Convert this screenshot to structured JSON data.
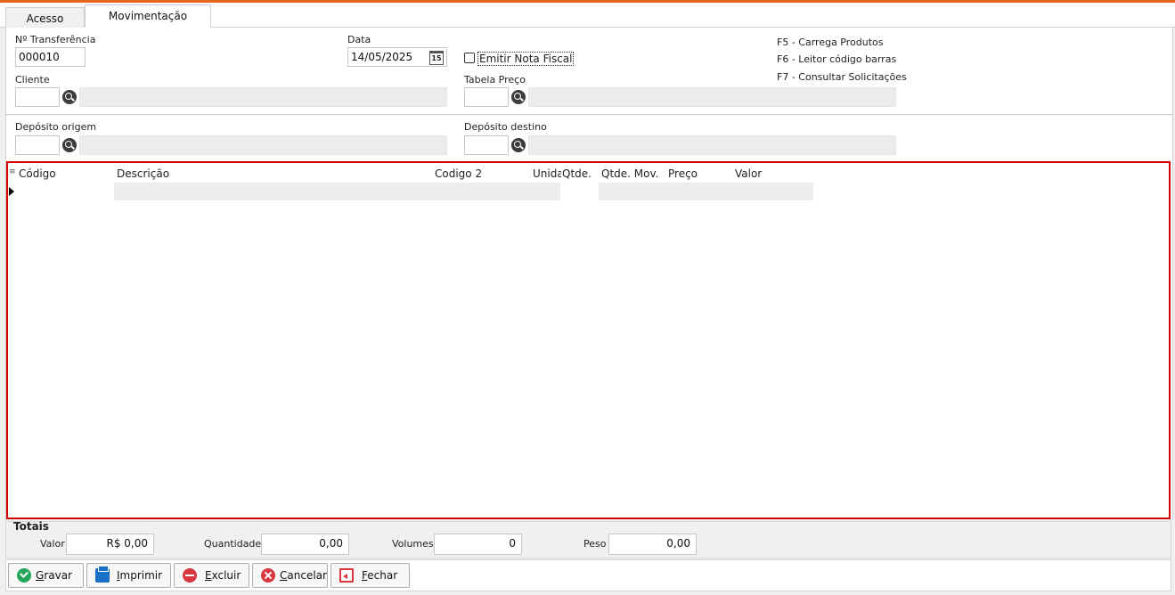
{
  "tabs": [
    {
      "label": "Acesso"
    },
    {
      "label": "Movimentação"
    }
  ],
  "form": {
    "transfer_number": {
      "label": "Nº Transferência",
      "value": "000010"
    },
    "date": {
      "label": "Data",
      "value": "14/05/2025"
    },
    "emit_invoice": {
      "label": "Emitir Nota Fiscal",
      "checked": false
    },
    "client": {
      "label": "Cliente",
      "code": "",
      "name": ""
    },
    "price_table": {
      "label": "Tabela Preço",
      "code": "",
      "name": ""
    },
    "origin_deposit": {
      "label": "Depósito origem",
      "code": "",
      "name": ""
    },
    "dest_deposit": {
      "label": "Depósito destino",
      "code": "",
      "name": ""
    },
    "shortcuts": [
      "F5 - Carrega Produtos",
      "F6 - Leitor código barras",
      "F7 - Consultar Solicitações"
    ]
  },
  "grid": {
    "columns": [
      "Código",
      "Descrição",
      "Codigo 2",
      "Unida",
      "Qtde.",
      "Qtde. Mov.",
      "Preço",
      "Valor"
    ]
  },
  "totals": {
    "title": "Totais",
    "valor": {
      "label": "Valor",
      "value": "R$ 0,00"
    },
    "quantidade": {
      "label": "Quantidade",
      "value": "0,00"
    },
    "volumes": {
      "label": "Volumes",
      "value": "0"
    },
    "peso": {
      "label": "Peso",
      "value": "0,00"
    }
  },
  "buttons": {
    "gravar": {
      "key": "G",
      "rest": "ravar"
    },
    "imprimir": {
      "key": "I",
      "rest": "mprimir"
    },
    "excluir": {
      "key": "E",
      "rest": "xcluir"
    },
    "cancelar": {
      "key": "C",
      "rest": "ancelar"
    },
    "fechar": {
      "key": "F",
      "rest": "echar"
    }
  },
  "colors": {
    "accent": "#e8641b",
    "grid_border": "#d40000"
  }
}
